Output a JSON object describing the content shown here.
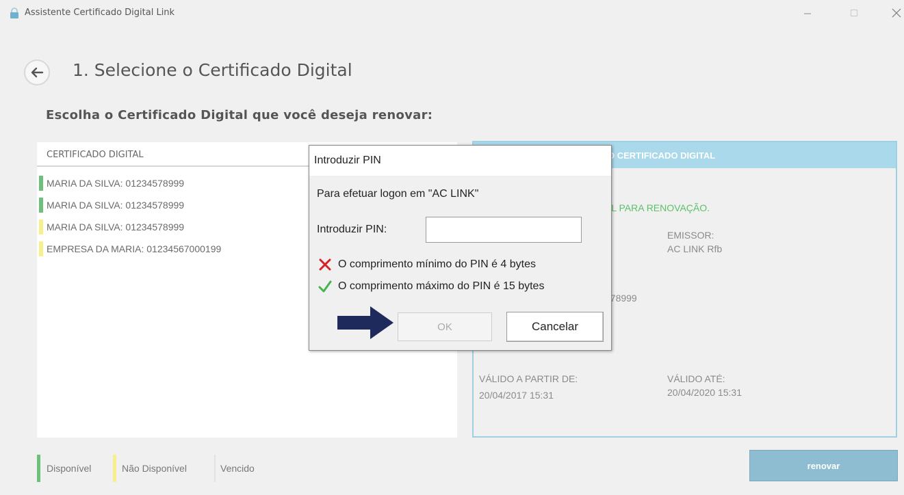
{
  "window": {
    "title": "Assistente Certificado Digital Link",
    "minimize_icon": "minimize-icon",
    "maximize_icon": "maximize-icon",
    "close_icon": "close-icon"
  },
  "header": {
    "step_title": "1. Selecione o Certificado Digital",
    "subtitle": "Escolha o Certificado Digital que você deseja renovar:"
  },
  "cert_list": {
    "column_header": "CERTIFICADO DIGITAL",
    "items": [
      {
        "name": "MARIA DA SILVA: 01234578999",
        "status_color": "#6cc07a"
      },
      {
        "name": "MARIA DA SILVA: 01234578999",
        "status_color": "#6cc07a"
      },
      {
        "name": "MARIA DA SILVA: 01234578999",
        "status_color": "#f7ef8a"
      },
      {
        "name": "EMPRESA DA MARIA: 01234567000199",
        "status_color": "#f7ef8a"
      }
    ]
  },
  "details": {
    "header": "O CERTIFICADO DIGITAL",
    "status": "EL PARA RENOVAÇÃO.",
    "issuer_label": "EMISSOR:",
    "issuer_value": "AC LINK Rfb",
    "doc_fragment": "578999",
    "valid_from_label": "VÁLIDO A PARTIR DE:",
    "valid_from_value": "20/04/2017 15:31",
    "valid_to_label": "VÁLIDO ATÉ:",
    "valid_to_value": "20/04/2020 15:31"
  },
  "legend": {
    "available": "Disponível",
    "unavailable": "Não Disponível",
    "expired": "Vencido"
  },
  "renew_button": "renovar",
  "dialog": {
    "title": "Introduzir PIN",
    "message": "Para efetuar logon em \"AC LINK\"",
    "pin_label": "Introduzir PIN:",
    "pin_value": "",
    "rule_min": "O comprimento mínimo do PIN é 4 bytes",
    "rule_max": "O comprimento máximo do PIN é 15 bytes",
    "ok_label": "OK",
    "cancel_label": "Cancelar"
  },
  "colors": {
    "accent": "#a9d9eb",
    "available": "#6cc07a",
    "unavailable": "#f7ef8a",
    "arrow": "#1f2a5c"
  }
}
